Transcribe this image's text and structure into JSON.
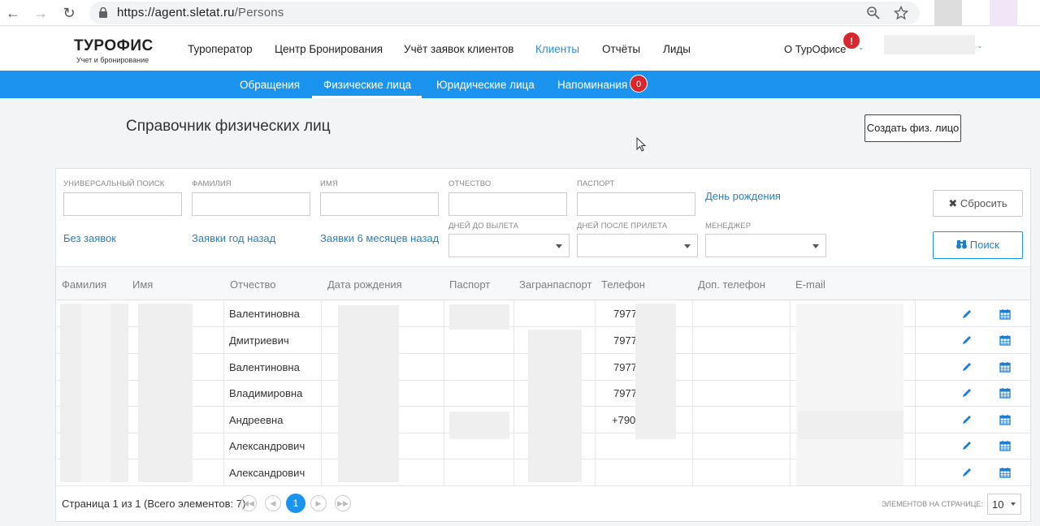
{
  "browser": {
    "url_host": "https://agent.sletat.ru",
    "url_path": "/Persons"
  },
  "header": {
    "logo_title": "ТУРОФИС",
    "logo_subtitle": "Учет и бронирование",
    "menu": [
      "Туроператор",
      "Центр Бронирования",
      "Учёт заявок клиентов",
      "Клиенты",
      "Отчёты",
      "Лиды"
    ],
    "active_menu": "Клиенты",
    "about_label": "О ТурОфисе",
    "about_alert": "!"
  },
  "subnav": {
    "items": [
      "Обращения",
      "Физические лица",
      "Юридические лица",
      "Напоминания"
    ],
    "active": "Физические лица",
    "reminders_count": "0"
  },
  "page": {
    "title": "Справочник физических лиц",
    "create_button": "Создать физ. лицо"
  },
  "filters": {
    "universal_search": "УНИВЕРСАЛЬНЫЙ ПОИСК",
    "last_name": "ФАМИЛИЯ",
    "first_name": "ИМЯ",
    "middle_name": "ОТЧЕСТВО",
    "passport": "ПАСПОРТ",
    "birthday_link": "День рождения",
    "days_before": "ДНЕЙ ДО ВЫЛЕТА",
    "days_after": "ДНЕЙ ПОСЛЕ ПРИЛЕТА",
    "manager": "МЕНЕДЖЕР",
    "no_orders_link": "Без заявок",
    "year_ago_link": "Заявки год назад",
    "six_months_link": "Заявки 6 месяцев назад",
    "reset_button": "Сбросить",
    "search_button": "Поиск"
  },
  "grid": {
    "columns": [
      "Фамилия",
      "Имя",
      "Отчество",
      "Дата рождения",
      "Паспорт",
      "Загранпаспорт",
      "Телефон",
      "Доп. телефон",
      "E-mail"
    ],
    "rows": [
      {
        "middle_name": "Валентиновна",
        "phone": "7977"
      },
      {
        "middle_name": "Дмитриевич",
        "phone": "7977"
      },
      {
        "middle_name": "Валентиновна",
        "phone": "7977"
      },
      {
        "middle_name": "Владимировна",
        "phone": "7977"
      },
      {
        "middle_name": "Андреевна",
        "phone": "+7903"
      },
      {
        "middle_name": "Александрович",
        "phone": ""
      },
      {
        "middle_name": "Александрович",
        "phone": ""
      }
    ]
  },
  "pager": {
    "info": "Страница 1 из 1 (Всего элементов: 7)",
    "current_page": "1",
    "page_size_label": "ЭЛЕМЕНТОВ НА СТРАНИЦЕ:",
    "page_size": "10"
  },
  "colors": {
    "accent": "#1a94ef",
    "link": "#2b7fb8",
    "badge": "#d9262c"
  }
}
